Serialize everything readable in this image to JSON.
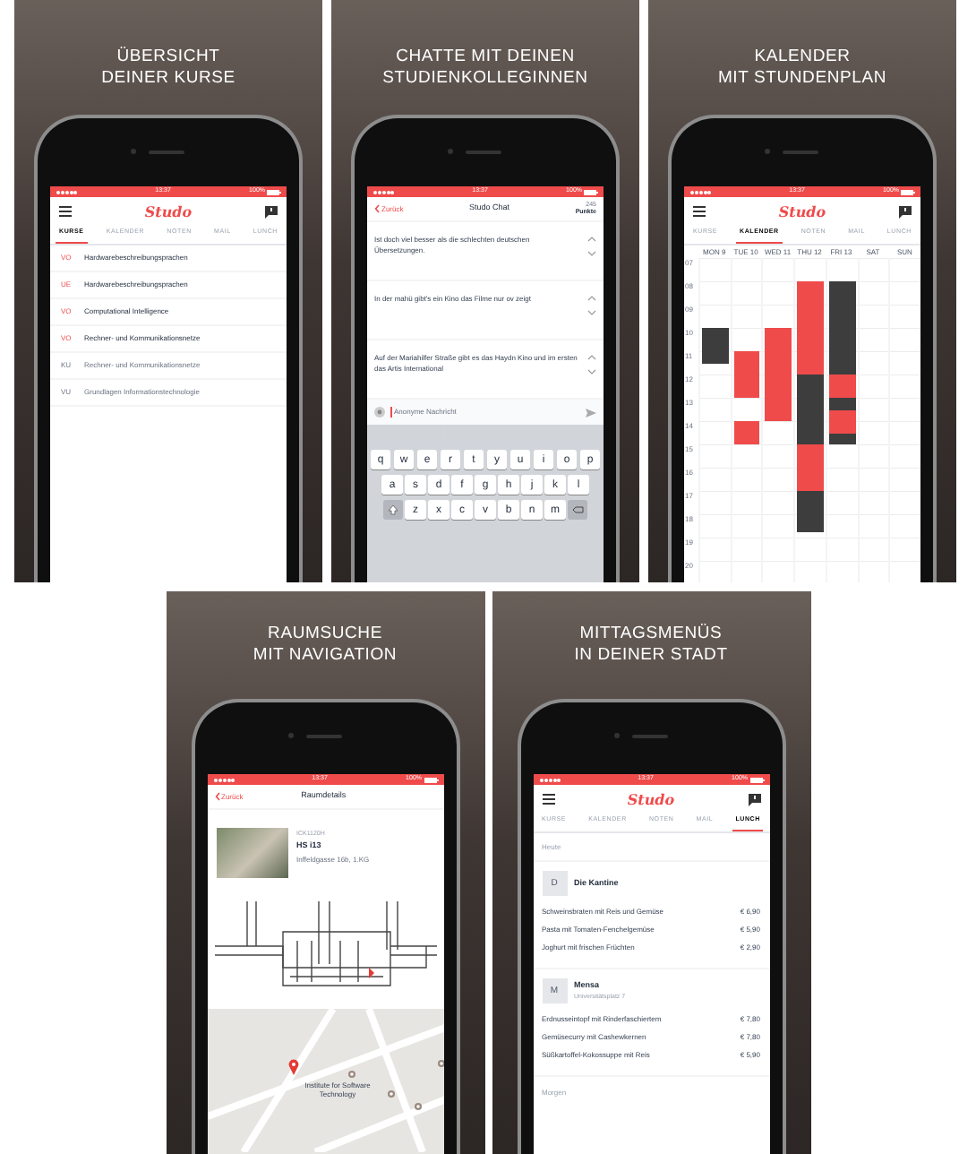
{
  "panels": [
    {
      "kind": "courses",
      "heading": [
        "ÜBERSICHT",
        "DEINER KURSE"
      ],
      "time": "13:37",
      "battery": "100%",
      "logo": "Studo",
      "tabs": [
        {
          "label": "KURSE",
          "selected": true
        },
        {
          "label": "KALENDER",
          "selected": false
        },
        {
          "label": "NOTEN",
          "selected": false
        },
        {
          "label": "MAIL",
          "selected": false
        },
        {
          "label": "LUNCH",
          "selected": false
        }
      ],
      "courses": [
        {
          "type": "VO",
          "name": "Hardwarebeschreibungsprachen",
          "disabled": false
        },
        {
          "type": "UE",
          "name": "Hardwarebeschreibungsprachen",
          "disabled": false
        },
        {
          "type": "VO",
          "name": "Computational Intelligence",
          "disabled": false
        },
        {
          "type": "VO",
          "name": "Rechner- und Kommunikationsnetze",
          "disabled": false
        },
        {
          "type": "KU",
          "name": "Rechner- und Kommunikationsnetze",
          "disabled": true
        },
        {
          "type": "VU",
          "name": "Grundlagen Informationstechnologie",
          "disabled": true
        }
      ]
    },
    {
      "kind": "chat",
      "heading": [
        "CHATTE MIT DEINEN",
        "STUDIENKOLLEGINNEN"
      ],
      "time": "13:37",
      "battery": "100%",
      "nav": {
        "back": "Zurück",
        "title": "Studo Chat",
        "points": "245",
        "points_label": "Punkte"
      },
      "messages": [
        {
          "text": "Ist doch viel besser als die schlechten deutschen Übersetzungen."
        },
        {
          "text": "In der mahü gibt's ein Kino das Filme nur ov zeigt"
        },
        {
          "text": "Auf der Mariahilfer Straße gibt es das Haydn Kino und im ersten das Artis International"
        }
      ],
      "placeholder": "Anonyme Nachricht",
      "keys": [
        [
          "q",
          "w",
          "e",
          "r",
          "t",
          "y",
          "u",
          "i",
          "o",
          "p"
        ],
        [
          "a",
          "s",
          "d",
          "f",
          "g",
          "h",
          "j",
          "k",
          "l"
        ],
        [
          "z",
          "x",
          "c",
          "v",
          "b",
          "n",
          "m"
        ]
      ]
    },
    {
      "kind": "calendar",
      "heading": [
        "KALENDER",
        "MIT STUNDENPLAN"
      ],
      "time": "13:37",
      "battery": "100%",
      "logo": "Studo",
      "tabs": [
        {
          "label": "KURSE",
          "selected": false
        },
        {
          "label": "KALENDER",
          "selected": true
        },
        {
          "label": "NOTEN",
          "selected": false
        },
        {
          "label": "MAIL",
          "selected": false
        },
        {
          "label": "LUNCH",
          "selected": false
        }
      ],
      "days": [
        {
          "label": "MON 9",
          "events": [
            {
              "color": "#3d3d3d"
            }
          ]
        },
        {
          "label": "TUE 10",
          "events": [
            {
              "color": "#ef4b4b"
            },
            {
              "color": "#ef4b4b"
            }
          ]
        },
        {
          "label": "WED 11",
          "events": [
            {
              "color": "#ef4b4b"
            }
          ]
        },
        {
          "label": "THU 12",
          "events": [
            {
              "color": "#ef4b4b"
            },
            {
              "color": "#3d3d3d"
            },
            {
              "color": "#ef4b4b"
            },
            {
              "color": "#3d3d3d"
            }
          ]
        },
        {
          "label": "FRI 13",
          "events": [
            {
              "color": "#3d3d3d"
            },
            {
              "color": "#ef4b4b"
            },
            {
              "color": "#3d3d3d"
            },
            {
              "color": "#ef4b4b"
            },
            {
              "color": "#3d3d3d"
            }
          ]
        },
        {
          "label": "SAT"
        },
        {
          "label": "SUN"
        }
      ],
      "hours": [
        "07",
        "08",
        "09",
        "10",
        "11",
        "12",
        "13",
        "14",
        "15",
        "16",
        "17",
        "18",
        "19",
        "20"
      ]
    },
    {
      "kind": "room",
      "heading": [
        "RAUMSUCHE",
        "MIT NAVIGATION"
      ],
      "time": "13:37",
      "battery": "100%",
      "nav": {
        "back": "Zurück",
        "title": "Raumdetails"
      },
      "code": "ICK1120H",
      "name": "HS i13",
      "address": "Inffeldgasse 16b, 1.KG",
      "map_label": "Institute for Software Technology"
    },
    {
      "kind": "lunch",
      "heading": [
        "MITTAGSMENÜS",
        "IN DEINER STADT"
      ],
      "time": "13:37",
      "battery": "100%",
      "logo": "Studo",
      "tabs": [
        {
          "label": "KURSE",
          "selected": false
        },
        {
          "label": "KALENDER",
          "selected": false
        },
        {
          "label": "NOTEN",
          "selected": false
        },
        {
          "label": "MAIL",
          "selected": false
        },
        {
          "label": "LUNCH",
          "selected": true
        }
      ],
      "day": "Heute",
      "restaurants": [
        {
          "initial": "D",
          "name": "Die Kantine",
          "dishes": [
            {
              "name": "Schweinsbraten mit Reis und Gemüse",
              "price": "€ 6,90"
            },
            {
              "name": "Pasta mit Tomaten-Fenchelgemüse",
              "price": "€ 5,90"
            },
            {
              "name": "Joghurt mit frischen Früchten",
              "price": "€ 2,90"
            }
          ]
        },
        {
          "initial": "M",
          "name": "Mensa",
          "address": "Universitätsplatz 7",
          "dishes": [
            {
              "name": "Erdnusseintopf mit Rinderfaschiertem",
              "price": "€ 7,80"
            },
            {
              "name": "Gemüsecurry mit Cashewkernen",
              "price": "€ 7,80"
            },
            {
              "name": "Süßkartoffel-Kokossuppe mit Reis",
              "price": "€ 5,90"
            }
          ]
        }
      ],
      "next_day": "Morgen"
    }
  ]
}
